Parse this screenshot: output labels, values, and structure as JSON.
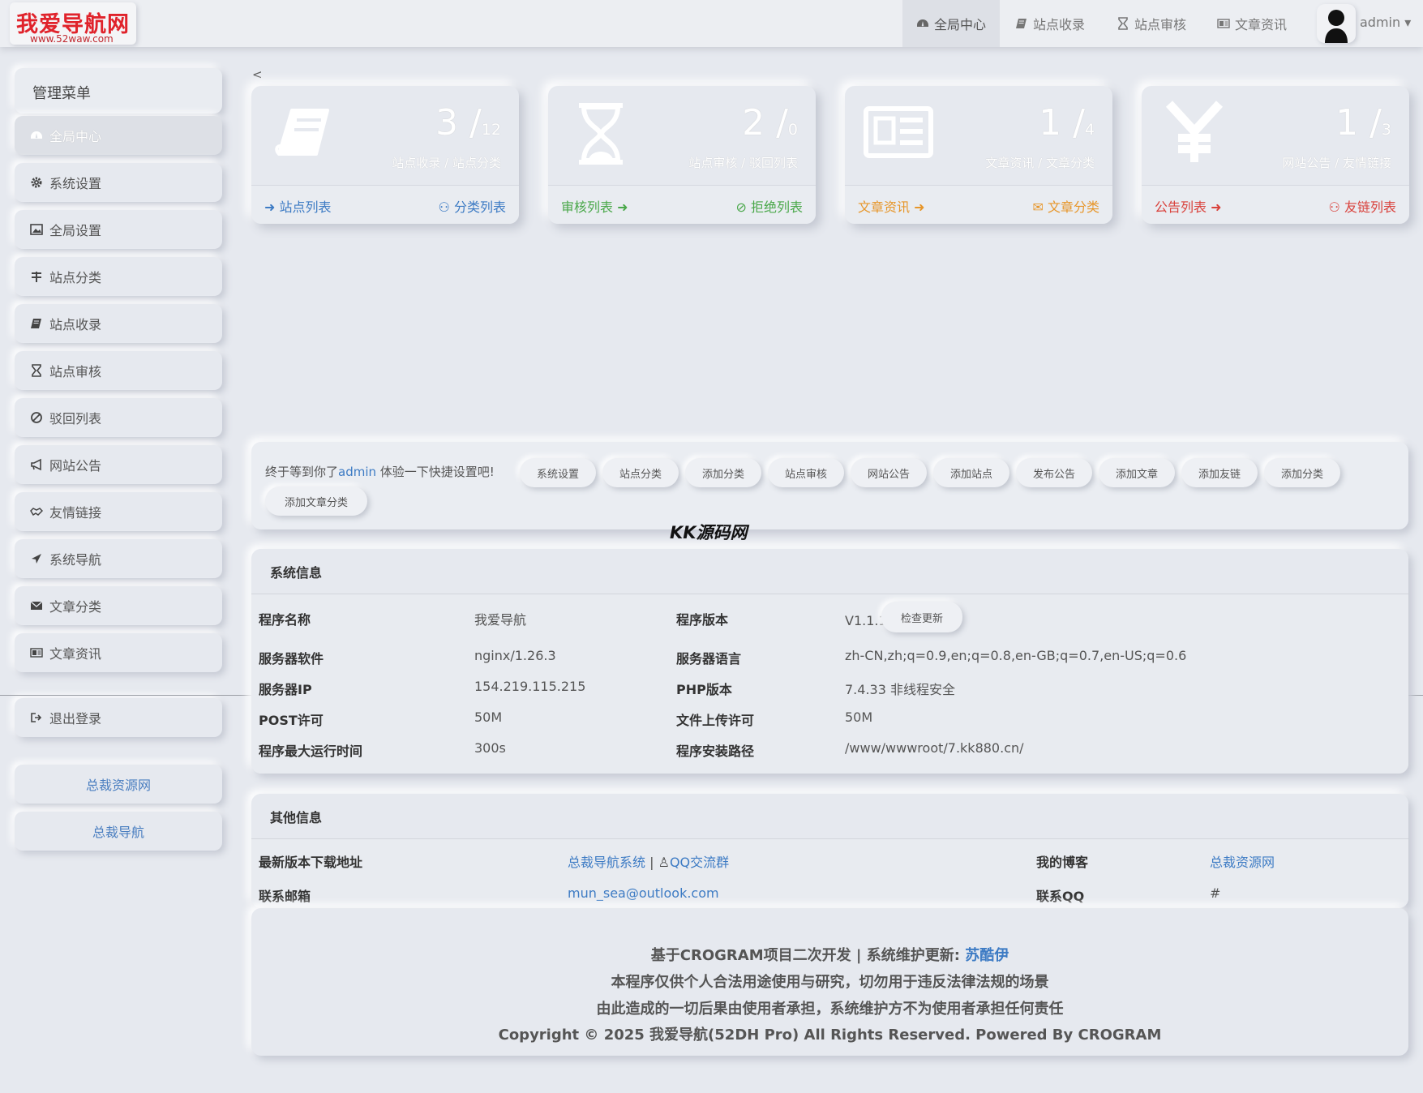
{
  "logo": {
    "title": "我爱导航网",
    "url": "www.52waw.com"
  },
  "topnav": [
    {
      "label": "全局中心",
      "icon": "dashboard-icon",
      "active": true
    },
    {
      "label": "站点收录",
      "icon": "book-icon"
    },
    {
      "label": "站点审核",
      "icon": "hourglass-icon"
    },
    {
      "label": "文章资讯",
      "icon": "newspaper-icon"
    }
  ],
  "user": {
    "name": "admin"
  },
  "sidebar": {
    "title": "管理菜单",
    "items": [
      {
        "label": "全局中心",
        "icon": "dashboard-icon"
      },
      {
        "label": "系统设置",
        "icon": "gear-icon"
      },
      {
        "label": "全局设置",
        "icon": "image-icon"
      },
      {
        "label": "站点分类",
        "icon": "sitemap-icon"
      },
      {
        "label": "站点收录",
        "icon": "book-icon"
      },
      {
        "label": "站点审核",
        "icon": "hourglass-icon"
      },
      {
        "label": "驳回列表",
        "icon": "ban-icon"
      },
      {
        "label": "网站公告",
        "icon": "bullhorn-icon"
      },
      {
        "label": "友情链接",
        "icon": "handshake-icon"
      },
      {
        "label": "系统导航",
        "icon": "location-arrow-icon"
      },
      {
        "label": "文章分类",
        "icon": "envelope-icon"
      },
      {
        "label": "文章资讯",
        "icon": "newspaper-icon"
      }
    ],
    "logout": "退出登录",
    "links": [
      "总裁资源网",
      "总裁导航"
    ]
  },
  "collapse": "<",
  "cards": [
    {
      "a": "3",
      "b": "12",
      "sub": "站点收录 / 站点分类",
      "left": "站点列表",
      "right": "分类列表",
      "color": "#3d7bc4",
      "icon": "book-icon"
    },
    {
      "a": "2",
      "b": "0",
      "sub": "站点审核 / 驳回列表",
      "left": "审核列表",
      "right": "拒绝列表",
      "color": "#4aa84a",
      "icon": "hourglass-icon"
    },
    {
      "a": "1",
      "b": "4",
      "sub": "文章资讯 / 文章分类",
      "left": "文章资讯",
      "right": "文章分类",
      "color": "#e7962a",
      "icon": "newspaper-icon"
    },
    {
      "a": "1",
      "b": "3",
      "sub": "网站公告 / 友情链接",
      "left": "公告列表",
      "right": "友链列表",
      "color": "#d9413b",
      "icon": "yen-icon"
    }
  ],
  "quick": {
    "pre": "终于等到你了",
    "user": "admin",
    "post": " 体验一下快捷设置吧!",
    "buttons": [
      "系统设置",
      "站点分类",
      "添加分类",
      "站点审核",
      "网站公告",
      "添加站点",
      "发布公告",
      "添加文章",
      "添加友链",
      "添加分类",
      "添加文章分类"
    ]
  },
  "watermark": "KK源码网",
  "sysinfo": {
    "title": "系统信息",
    "rows": [
      {
        "l1": "程序名称",
        "v1": "我爱导航",
        "l2": "程序版本",
        "v2": "V1.1.1"
      },
      {
        "l1": "服务器软件",
        "v1": "nginx/1.26.3",
        "l2": "服务器语言",
        "v2": "zh-CN,zh;q=0.9,en;q=0.8,en-GB;q=0.7,en-US;q=0.6"
      },
      {
        "l1": "服务器IP",
        "v1": "154.219.115.215",
        "l2": "PHP版本",
        "v2": "7.4.33 非线程安全"
      },
      {
        "l1": "POST许可",
        "v1": "50M",
        "l2": "文件上传许可",
        "v2": "50M"
      },
      {
        "l1": "程序最大运行时间",
        "v1": "300s",
        "l2": "程序安装路径",
        "v2": "/www/wwwroot/7.kk880.cn/"
      }
    ],
    "check_update": "检查更新"
  },
  "otherinfo": {
    "title": "其他信息",
    "download_label": "最新版本下载地址",
    "download_link": "总裁导航系统",
    "sep": "|",
    "qq_group": "QQ交流群",
    "blog_label": "我的博客",
    "blog_link": "总裁资源网",
    "email_label": "联系邮箱",
    "email": "mun_sea@outlook.com",
    "qq_label": "联系QQ",
    "qq": "#"
  },
  "footer": {
    "line1_pre": "基于CROGRAM项目二次开发 | 系统维护更新:",
    "line1_name": "苏酷伊",
    "line2": "本程序仅供个人合法用途使用与研究，切勿用于违反法律法规的场景",
    "line3": "由此造成的一切后果由使用者承担，系统维护方不为使用者承担任何责任",
    "line4": "Copyright © 2025 我爱导航(52DH Pro) All Rights Reserved. Powered By CROGRAM"
  }
}
